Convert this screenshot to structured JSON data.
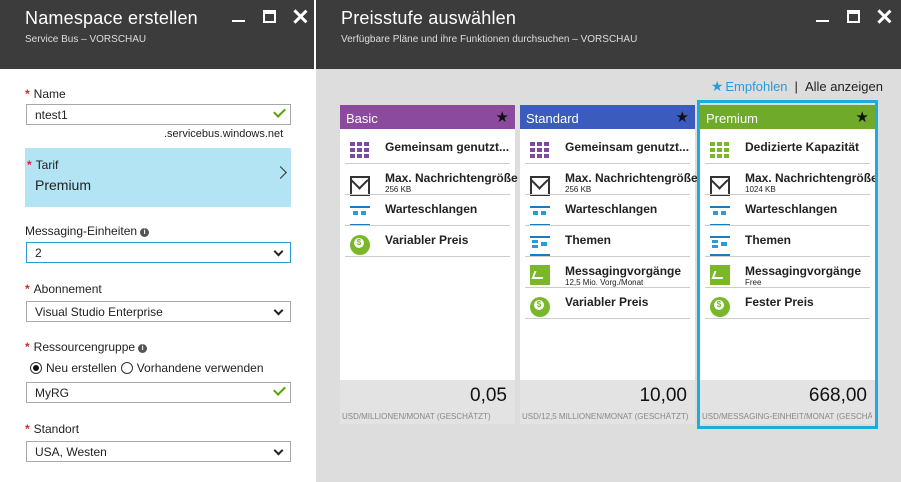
{
  "left_blade": {
    "title": "Namespace erstellen",
    "subtitle": "Service Bus – VORSCHAU",
    "name_label": "Name",
    "name_value": "ntest1",
    "name_suffix": ".servicebus.windows.net",
    "tarif_label": "Tarif",
    "tarif_value": "Premium",
    "messaging_label": "Messaging-Einheiten",
    "messaging_value": "2",
    "abo_label": "Abonnement",
    "abo_value": "Visual Studio Enterprise",
    "rg_label": "Ressourcengruppe",
    "rg_new": "Neu erstellen",
    "rg_existing": "Vorhandene verwenden",
    "rg_value": "MyRG",
    "location_label": "Standort",
    "location_value": "USA, Westen"
  },
  "right_blade": {
    "title": "Preisstufe auswählen",
    "subtitle": "Verfügbare Pläne und ihre Funktionen durchsuchen – VORSCHAU",
    "recommended": "Empfohlen",
    "separator": "|",
    "show_all": "Alle anzeigen",
    "cards": [
      {
        "name": "Basic",
        "color": "#8c4a9e",
        "features": [
          {
            "icon": "shared-capacity-icon",
            "title": "Gemeinsam genutzt..."
          },
          {
            "icon": "message-size-icon",
            "title": "Max. Nachrichtengröße",
            "sub": "256 KB"
          },
          {
            "icon": "queue-icon",
            "title": "Warteschlangen"
          },
          {
            "icon": "price-coin-icon",
            "title": "Variabler Preis"
          }
        ],
        "price": "0,05",
        "unit": "USD/MILLIONEN/MONAT (GESCHÄTZT)"
      },
      {
        "name": "Standard",
        "color": "#3b5bbf",
        "features": [
          {
            "icon": "shared-capacity-icon",
            "title": "Gemeinsam genutzt..."
          },
          {
            "icon": "message-size-icon",
            "title": "Max. Nachrichtengröße",
            "sub": "256 KB"
          },
          {
            "icon": "queue-icon",
            "title": "Warteschlangen"
          },
          {
            "icon": "topic-icon",
            "title": "Themen"
          },
          {
            "icon": "messaging-ops-icon",
            "title": "Messagingvorgänge",
            "sub": "12,5 Mio. Vorg./Monat"
          },
          {
            "icon": "price-coin-icon",
            "title": "Variabler Preis"
          }
        ],
        "price": "10,00",
        "unit": "USD/12,5 MILLIONEN/MONAT (GESCHÄTZT)"
      },
      {
        "name": "Premium",
        "color": "#6faa2b",
        "features": [
          {
            "icon": "dedicated-capacity-icon",
            "title": "Dedizierte Kapazität"
          },
          {
            "icon": "message-size-icon",
            "title": "Max. Nachrichtengröße",
            "sub": "1024 KB"
          },
          {
            "icon": "queue-icon",
            "title": "Warteschlangen"
          },
          {
            "icon": "topic-icon",
            "title": "Themen"
          },
          {
            "icon": "messaging-ops-icon",
            "title": "Messagingvorgänge",
            "sub": "Free"
          },
          {
            "icon": "price-coin-icon",
            "title": "Fester Preis"
          }
        ],
        "price": "668,00",
        "unit": "USD/MESSAGING-EINHEIT/MONAT (GESCHÄTZT)"
      }
    ]
  }
}
